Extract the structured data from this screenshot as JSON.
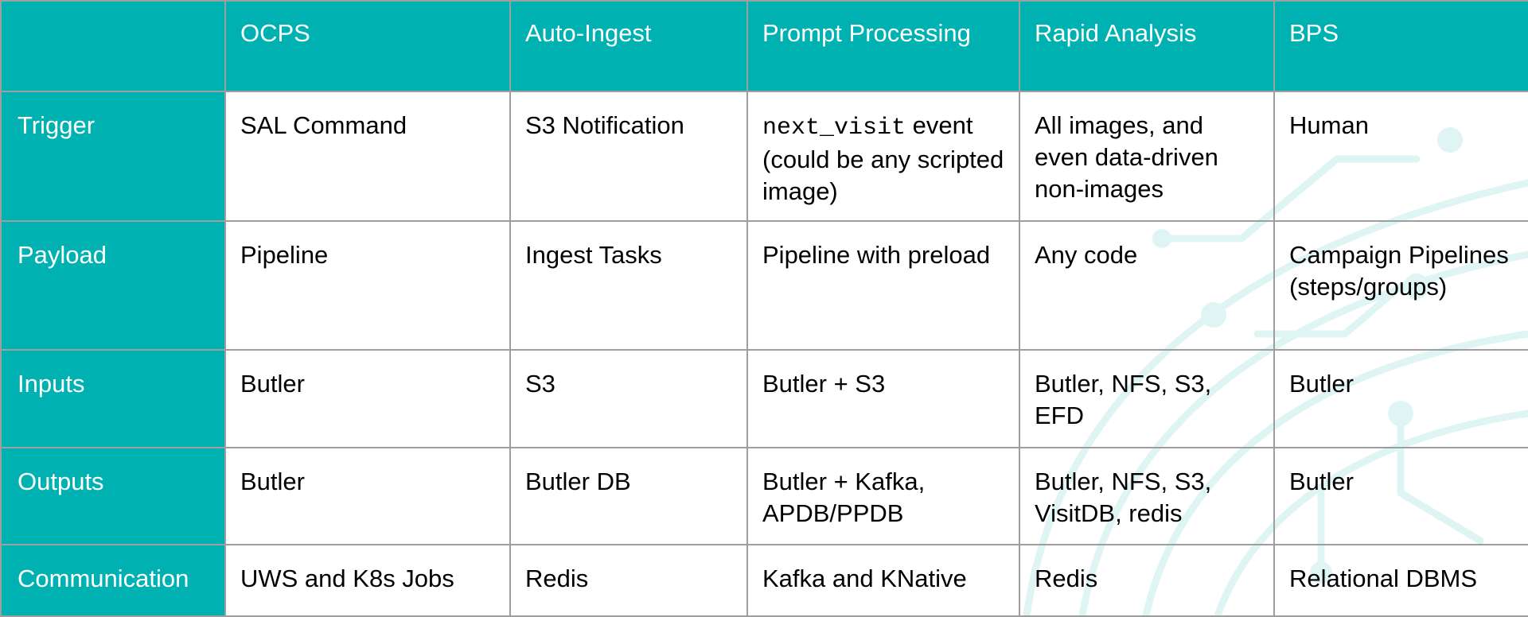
{
  "colors": {
    "header_bg": "#00b1b1",
    "header_text": "#ffffff",
    "grid": "#9e9e9e",
    "decor": "#dff5f4"
  },
  "columns": [
    "",
    "OCPS",
    "Auto-Ingest",
    "Prompt Processing",
    "Rapid Analysis",
    "BPS"
  ],
  "rows": [
    {
      "label": "Trigger",
      "cells": [
        {
          "text": "SAL Command"
        },
        {
          "text": "S3 Notification"
        },
        {
          "code": "next_visit",
          "text": " event (could be any scripted image)"
        },
        {
          "text": "All images, and even data-driven non-images"
        },
        {
          "text": "Human"
        }
      ]
    },
    {
      "label": "Payload",
      "cells": [
        {
          "text": "Pipeline"
        },
        {
          "text": "Ingest Tasks"
        },
        {
          "text": "Pipeline with preload"
        },
        {
          "text": "Any code"
        },
        {
          "text": "Campaign Pipelines (steps/groups)"
        }
      ]
    },
    {
      "label": "Inputs",
      "cells": [
        {
          "text": "Butler"
        },
        {
          "text": "S3"
        },
        {
          "text": "Butler + S3"
        },
        {
          "text": "Butler, NFS, S3, EFD"
        },
        {
          "text": "Butler"
        }
      ]
    },
    {
      "label": "Outputs",
      "cells": [
        {
          "text": "Butler"
        },
        {
          "text": "Butler DB"
        },
        {
          "text": "Butler + Kafka, APDB/PPDB"
        },
        {
          "text": "Butler, NFS, S3, VisitDB, redis"
        },
        {
          "text": "Butler"
        }
      ]
    },
    {
      "label": "Communication",
      "cells": [
        {
          "text": "UWS and K8s Jobs"
        },
        {
          "text": "Redis"
        },
        {
          "text": "Kafka and KNative"
        },
        {
          "text": "Redis"
        },
        {
          "text": "Relational DBMS"
        }
      ]
    }
  ]
}
